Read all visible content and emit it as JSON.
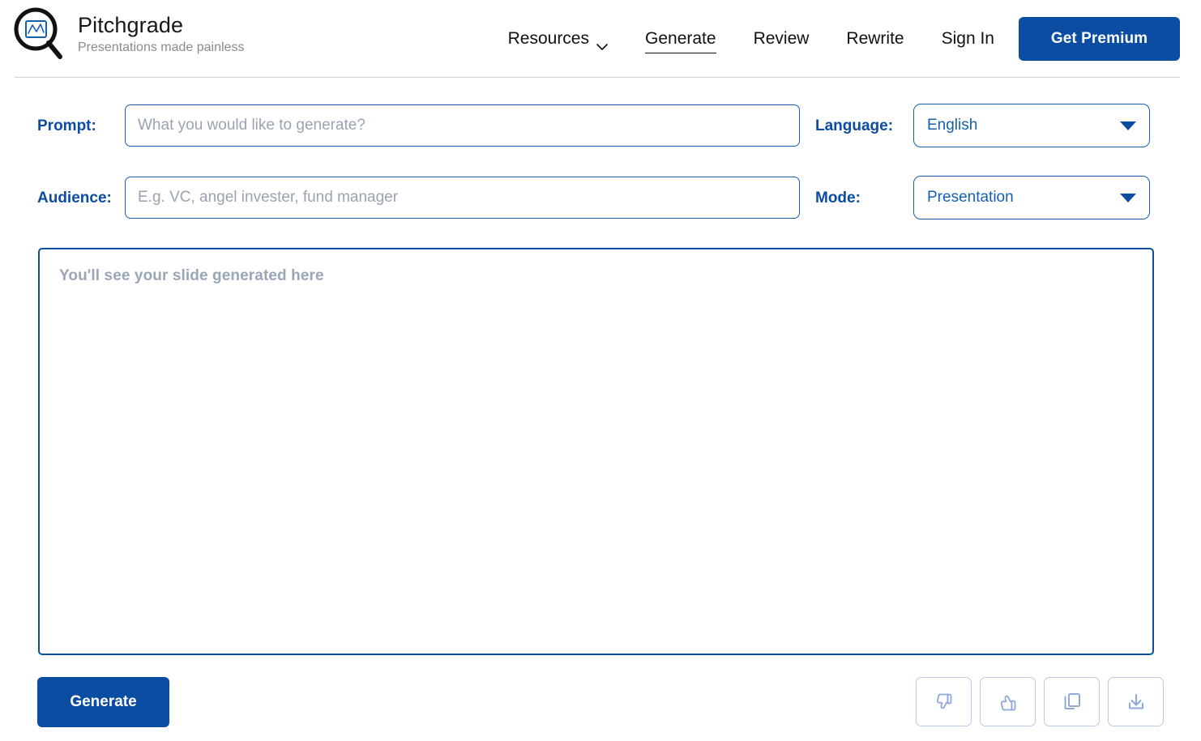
{
  "header": {
    "brand_title": "Pitchgrade",
    "brand_tagline": "Presentations made painless",
    "logo_icon": "magnifier-chart-logo-icon",
    "nav": [
      {
        "label": "Resources",
        "icon": "chevron-down-icon",
        "active": false,
        "has_dropdown": true
      },
      {
        "label": "Generate",
        "active": true,
        "has_dropdown": false
      },
      {
        "label": "Review",
        "active": false,
        "has_dropdown": false
      },
      {
        "label": "Rewrite",
        "active": false,
        "has_dropdown": false
      },
      {
        "label": "Sign In",
        "active": false,
        "has_dropdown": false
      }
    ],
    "premium_button": "Get Premium"
  },
  "form": {
    "prompt": {
      "label": "Prompt:",
      "placeholder": "What you would like to generate?",
      "value": ""
    },
    "audience": {
      "label": "Audience:",
      "placeholder": "E.g. VC, angel invester, fund manager",
      "value": ""
    },
    "language": {
      "label": "Language:",
      "selected": "English",
      "caret_icon": "caret-down-icon"
    },
    "mode": {
      "label": "Mode:",
      "selected": "Presentation",
      "caret_icon": "caret-down-icon"
    }
  },
  "output": {
    "placeholder": "You'll see your slide generated here"
  },
  "actions": {
    "generate_label": "Generate",
    "icon_buttons": [
      {
        "name": "thumbs-down-icon",
        "title": "Dislike"
      },
      {
        "name": "thumbs-up-icon",
        "title": "Like"
      },
      {
        "name": "copy-icon",
        "title": "Copy"
      },
      {
        "name": "download-icon",
        "title": "Download"
      }
    ]
  },
  "colors": {
    "primary_blue": "#0b4da2",
    "border_blue": "#1461b0",
    "placeholder_gray": "#9aa3b2",
    "output_placeholder": "#9aa5b8",
    "icon_blue": "#8fa9d8",
    "icon_border": "#b9cbe8",
    "divider": "#d3d3d6",
    "text_dark": "#111114",
    "tagline_gray": "#8a8a8f"
  }
}
